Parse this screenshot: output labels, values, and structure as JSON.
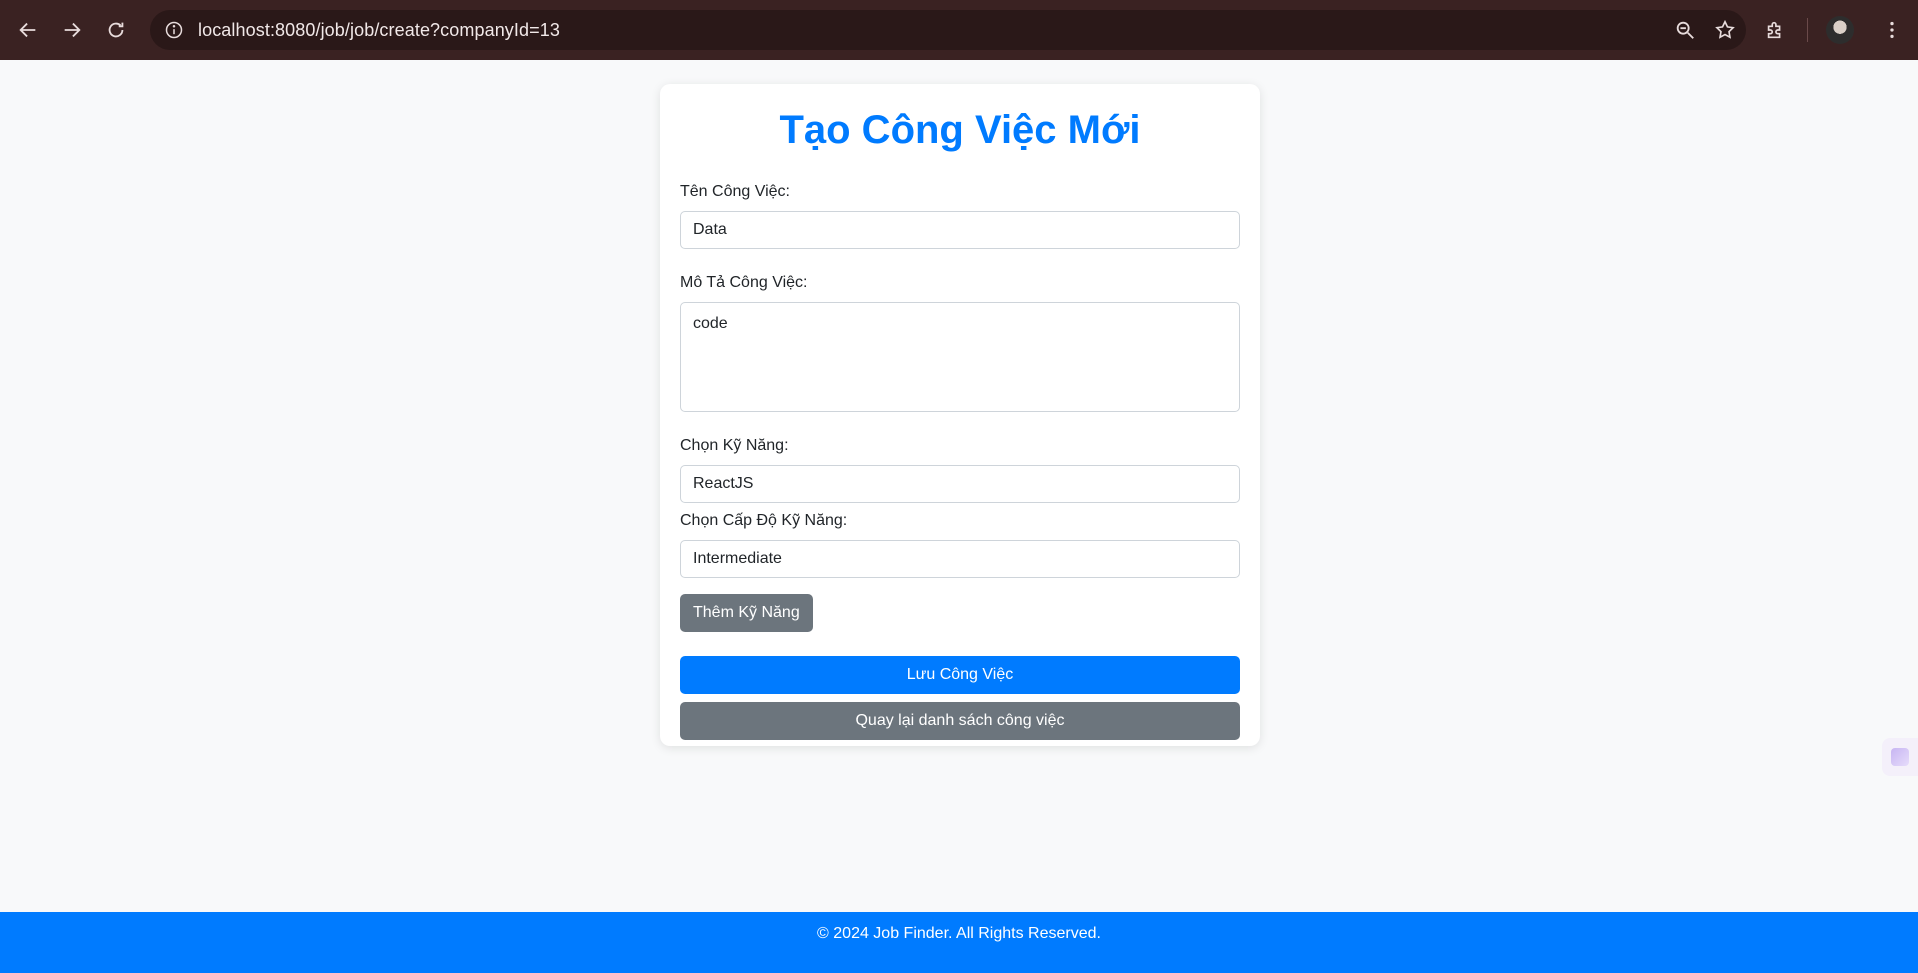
{
  "browser": {
    "url": "localhost:8080/job/job/create?companyId=13",
    "icons": [
      "back-arrow-icon",
      "forward-arrow-icon",
      "reload-icon",
      "site-info-icon",
      "zoom-icon",
      "bookmark-star-icon",
      "extensions-icon",
      "profile-avatar",
      "more-menu-icon"
    ]
  },
  "form": {
    "title": "Tạo Công Việc Mới",
    "job_name_label": "Tên Công Việc:",
    "job_name_value": "Data",
    "description_label": "Mô Tả Công Việc:",
    "description_value": "code",
    "skill_label": "Chọn Kỹ Năng:",
    "skill_value": "ReactJS",
    "skill_level_label": "Chọn Cấp Độ Kỹ Năng:",
    "skill_level_value": "Intermediate",
    "add_skill_button": "Thêm Kỹ Năng",
    "save_button": "Lưu Công Việc",
    "back_button": "Quay lại danh sách công việc"
  },
  "footer": {
    "text": "© 2024 Job Finder. All Rights Reserved."
  },
  "colors": {
    "primary": "#007bff",
    "secondary": "#6c757d",
    "browser_bar": "#3a2222",
    "page_bg": "#f8f9fa"
  }
}
